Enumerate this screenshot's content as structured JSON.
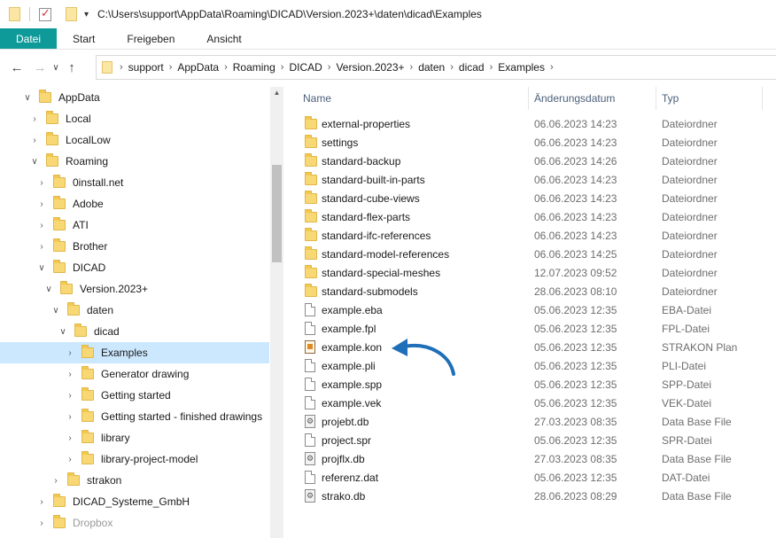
{
  "window": {
    "title": "C:\\Users\\support\\AppData\\Roaming\\DICAD\\Version.2023+\\daten\\dicad\\Examples"
  },
  "ribbon": {
    "tabs": [
      "Datei",
      "Start",
      "Freigeben",
      "Ansicht"
    ]
  },
  "nav": {
    "back": "←",
    "forward": "→",
    "recent": "∨",
    "up": "↑",
    "breadcrumbs": [
      "support",
      "AppData",
      "Roaming",
      "DICAD",
      "Version.2023+",
      "daten",
      "dicad",
      "Examples"
    ]
  },
  "tree": [
    {
      "label": "AppData",
      "chevron": "∨"
    },
    {
      "label": "Local",
      "chevron": "›"
    },
    {
      "label": "LocalLow",
      "chevron": "›"
    },
    {
      "label": "Roaming",
      "chevron": "∨"
    },
    {
      "label": "0install.net",
      "chevron": "›"
    },
    {
      "label": "Adobe",
      "chevron": "›"
    },
    {
      "label": "ATI",
      "chevron": "›"
    },
    {
      "label": "Brother",
      "chevron": "›"
    },
    {
      "label": "DICAD",
      "chevron": "∨"
    },
    {
      "label": "Version.2023+",
      "chevron": "∨"
    },
    {
      "label": "daten",
      "chevron": "∨"
    },
    {
      "label": "dicad",
      "chevron": "∨"
    },
    {
      "label": "Examples",
      "chevron": "›"
    },
    {
      "label": "Generator drawing",
      "chevron": "›"
    },
    {
      "label": "Getting started",
      "chevron": "›"
    },
    {
      "label": "Getting started - finished drawings",
      "chevron": "›"
    },
    {
      "label": "library",
      "chevron": "›"
    },
    {
      "label": "library-project-model",
      "chevron": "›"
    },
    {
      "label": "strakon",
      "chevron": "›"
    },
    {
      "label": "DICAD_Systeme_GmbH",
      "chevron": "›"
    },
    {
      "label": "Dropbox",
      "chevron": "›"
    }
  ],
  "columns": {
    "name": "Name",
    "date": "Änderungsdatum",
    "type": "Typ",
    "sort_indicator": "^"
  },
  "files": [
    {
      "name": "external-properties",
      "date": "06.06.2023 14:23",
      "type": "Dateiordner",
      "icon": "folder-icon"
    },
    {
      "name": "settings",
      "date": "06.06.2023 14:23",
      "type": "Dateiordner",
      "icon": "folder-icon"
    },
    {
      "name": "standard-backup",
      "date": "06.06.2023 14:26",
      "type": "Dateiordner",
      "icon": "folder-icon"
    },
    {
      "name": "standard-built-in-parts",
      "date": "06.06.2023 14:23",
      "type": "Dateiordner",
      "icon": "folder-icon"
    },
    {
      "name": "standard-cube-views",
      "date": "06.06.2023 14:23",
      "type": "Dateiordner",
      "icon": "folder-icon"
    },
    {
      "name": "standard-flex-parts",
      "date": "06.06.2023 14:23",
      "type": "Dateiordner",
      "icon": "folder-icon"
    },
    {
      "name": "standard-ifc-references",
      "date": "06.06.2023 14:23",
      "type": "Dateiordner",
      "icon": "folder-icon"
    },
    {
      "name": "standard-model-references",
      "date": "06.06.2023 14:25",
      "type": "Dateiordner",
      "icon": "folder-icon"
    },
    {
      "name": "standard-special-meshes",
      "date": "12.07.2023 09:52",
      "type": "Dateiordner",
      "icon": "folder-icon"
    },
    {
      "name": "standard-submodels",
      "date": "28.06.2023 08:10",
      "type": "Dateiordner",
      "icon": "folder-icon"
    },
    {
      "name": "example.eba",
      "date": "05.06.2023 12:35",
      "type": "EBA-Datei",
      "icon": "file-icon"
    },
    {
      "name": "example.fpl",
      "date": "05.06.2023 12:35",
      "type": "FPL-Datei",
      "icon": "file-icon"
    },
    {
      "name": "example.kon",
      "date": "05.06.2023 12:35",
      "type": "STRAKON Plan",
      "icon": "strakon-plan-icon"
    },
    {
      "name": "example.pli",
      "date": "05.06.2023 12:35",
      "type": "PLI-Datei",
      "icon": "file-icon"
    },
    {
      "name": "example.spp",
      "date": "05.06.2023 12:35",
      "type": "SPP-Datei",
      "icon": "file-icon"
    },
    {
      "name": "example.vek",
      "date": "05.06.2023 12:35",
      "type": "VEK-Datei",
      "icon": "file-icon"
    },
    {
      "name": "projebt.db",
      "date": "27.03.2023 08:35",
      "type": "Data Base File",
      "icon": "database-file-icon"
    },
    {
      "name": "project.spr",
      "date": "05.06.2023 12:35",
      "type": "SPR-Datei",
      "icon": "file-icon"
    },
    {
      "name": "projflx.db",
      "date": "27.03.2023 08:35",
      "type": "Data Base File",
      "icon": "database-file-icon"
    },
    {
      "name": "referenz.dat",
      "date": "05.06.2023 12:35",
      "type": "DAT-Datei",
      "icon": "file-icon"
    },
    {
      "name": "strako.db",
      "date": "28.06.2023 08:29",
      "type": "Data Base File",
      "icon": "database-file-icon"
    }
  ],
  "annotation": {
    "arrow_color": "#1e6fb8",
    "points_to": "example.kon"
  },
  "colors": {
    "file_tab": "#0f9a9a",
    "selection": "#cce8ff",
    "folder": "#f8d775"
  }
}
